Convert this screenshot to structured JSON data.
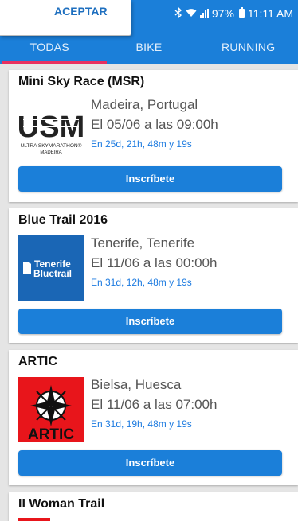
{
  "status_bar": {
    "battery": "97%",
    "time": "11:11 AM"
  },
  "toast": {
    "action": "ACEPTAR"
  },
  "tabs": [
    {
      "label": "TODAS"
    },
    {
      "label": "BIKE"
    },
    {
      "label": "RUNNING"
    }
  ],
  "colors": {
    "primary": "#1b7fd9",
    "indicator": "#e8305f",
    "countdown": "#1d7be0"
  },
  "events": [
    {
      "title": "Mini Sky Race (MSR)",
      "logo_text": {
        "main": "USM",
        "sub1": "ULTRA SKYMARATHON®",
        "sub2": "MADEIRA"
      },
      "location": "Madeira, Portugal",
      "date": "El 05/06 a las 09:00h",
      "countdown": "En 25d, 21h, 48m y 19s",
      "button": "Inscríbete"
    },
    {
      "title": "Blue Trail 2016",
      "logo_text": {
        "line1": "Tenerife",
        "line2": "Bluetrail"
      },
      "location": "Tenerife, Tenerife",
      "date": "El 11/06 a las 00:00h",
      "countdown": "En 31d, 12h, 48m y 19s",
      "button": "Inscríbete"
    },
    {
      "title": "ARTIC",
      "logo_text": {
        "main": "ARTIC"
      },
      "location": "Bielsa, Huesca",
      "date": "El 11/06 a las 07:00h",
      "countdown": "En 31d, 19h, 48m y 19s",
      "button": "Inscríbete"
    },
    {
      "title": "II Woman Trail"
    }
  ]
}
